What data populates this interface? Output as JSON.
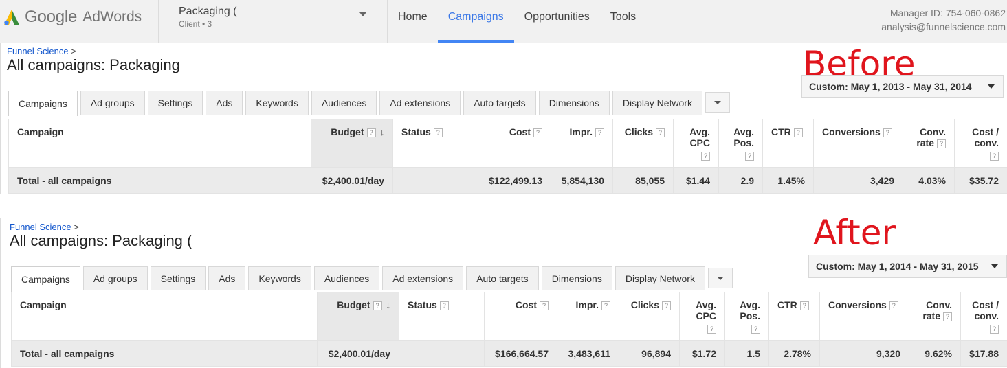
{
  "header": {
    "logo_google": "Google",
    "logo_adwords": "AdWords",
    "account_name": "Packaging (",
    "account_client": "Client • 3",
    "nav": [
      {
        "label": "Home",
        "active": false
      },
      {
        "label": "Campaigns",
        "active": true
      },
      {
        "label": "Opportunities",
        "active": false
      },
      {
        "label": "Tools",
        "active": false
      }
    ],
    "manager_id": "Manager ID: 754-060-0862",
    "email": "analysis@funnelscience.com"
  },
  "colors": {
    "accent": "#4285f4",
    "annotation": "#e0151d"
  },
  "tabs": [
    "Campaigns",
    "Ad groups",
    "Settings",
    "Ads",
    "Keywords",
    "Audiences",
    "Ad extensions",
    "Auto targets",
    "Dimensions",
    "Display Network"
  ],
  "columns": {
    "campaign": "Campaign",
    "budget": "Budget",
    "status": "Status",
    "cost": "Cost",
    "impr": "Impr.",
    "clicks": "Clicks",
    "avg_cpc_1": "Avg.",
    "avg_cpc_2": "CPC",
    "avg_pos_1": "Avg.",
    "avg_pos_2": "Pos.",
    "ctr": "CTR",
    "conversions": "Conversions",
    "conv_rate_1": "Conv.",
    "conv_rate_2": "rate",
    "cost_conv_1": "Cost /",
    "cost_conv_2": "conv.",
    "help": "?",
    "sort_arrow": "↓"
  },
  "before": {
    "annotation": "Before",
    "breadcrumb": "Funnel Science",
    "breadcrumb_sep": ">",
    "title": "All campaigns: Packaging",
    "date_range": "Custom: May 1, 2013 - May 31, 2014",
    "total": {
      "label": "Total - all campaigns",
      "budget": "$2,400.01/day",
      "status": "",
      "cost": "$122,499.13",
      "impr": "5,854,130",
      "clicks": "85,055",
      "avg_cpc": "$1.44",
      "avg_pos": "2.9",
      "ctr": "1.45%",
      "conversions": "3,429",
      "conv_rate": "4.03%",
      "cost_conv": "$35.72"
    }
  },
  "after": {
    "annotation": "After",
    "breadcrumb": "Funnel Science",
    "breadcrumb_sep": ">",
    "title": "All campaigns: Packaging (",
    "date_range": "Custom: May 1, 2014 - May 31, 2015",
    "total": {
      "label": "Total - all campaigns",
      "budget": "$2,400.01/day",
      "status": "",
      "cost": "$166,664.57",
      "impr": "3,483,611",
      "clicks": "96,894",
      "avg_cpc": "$1.72",
      "avg_pos": "1.5",
      "ctr": "2.78%",
      "conversions": "9,320",
      "conv_rate": "9.62%",
      "cost_conv": "$17.88"
    }
  }
}
